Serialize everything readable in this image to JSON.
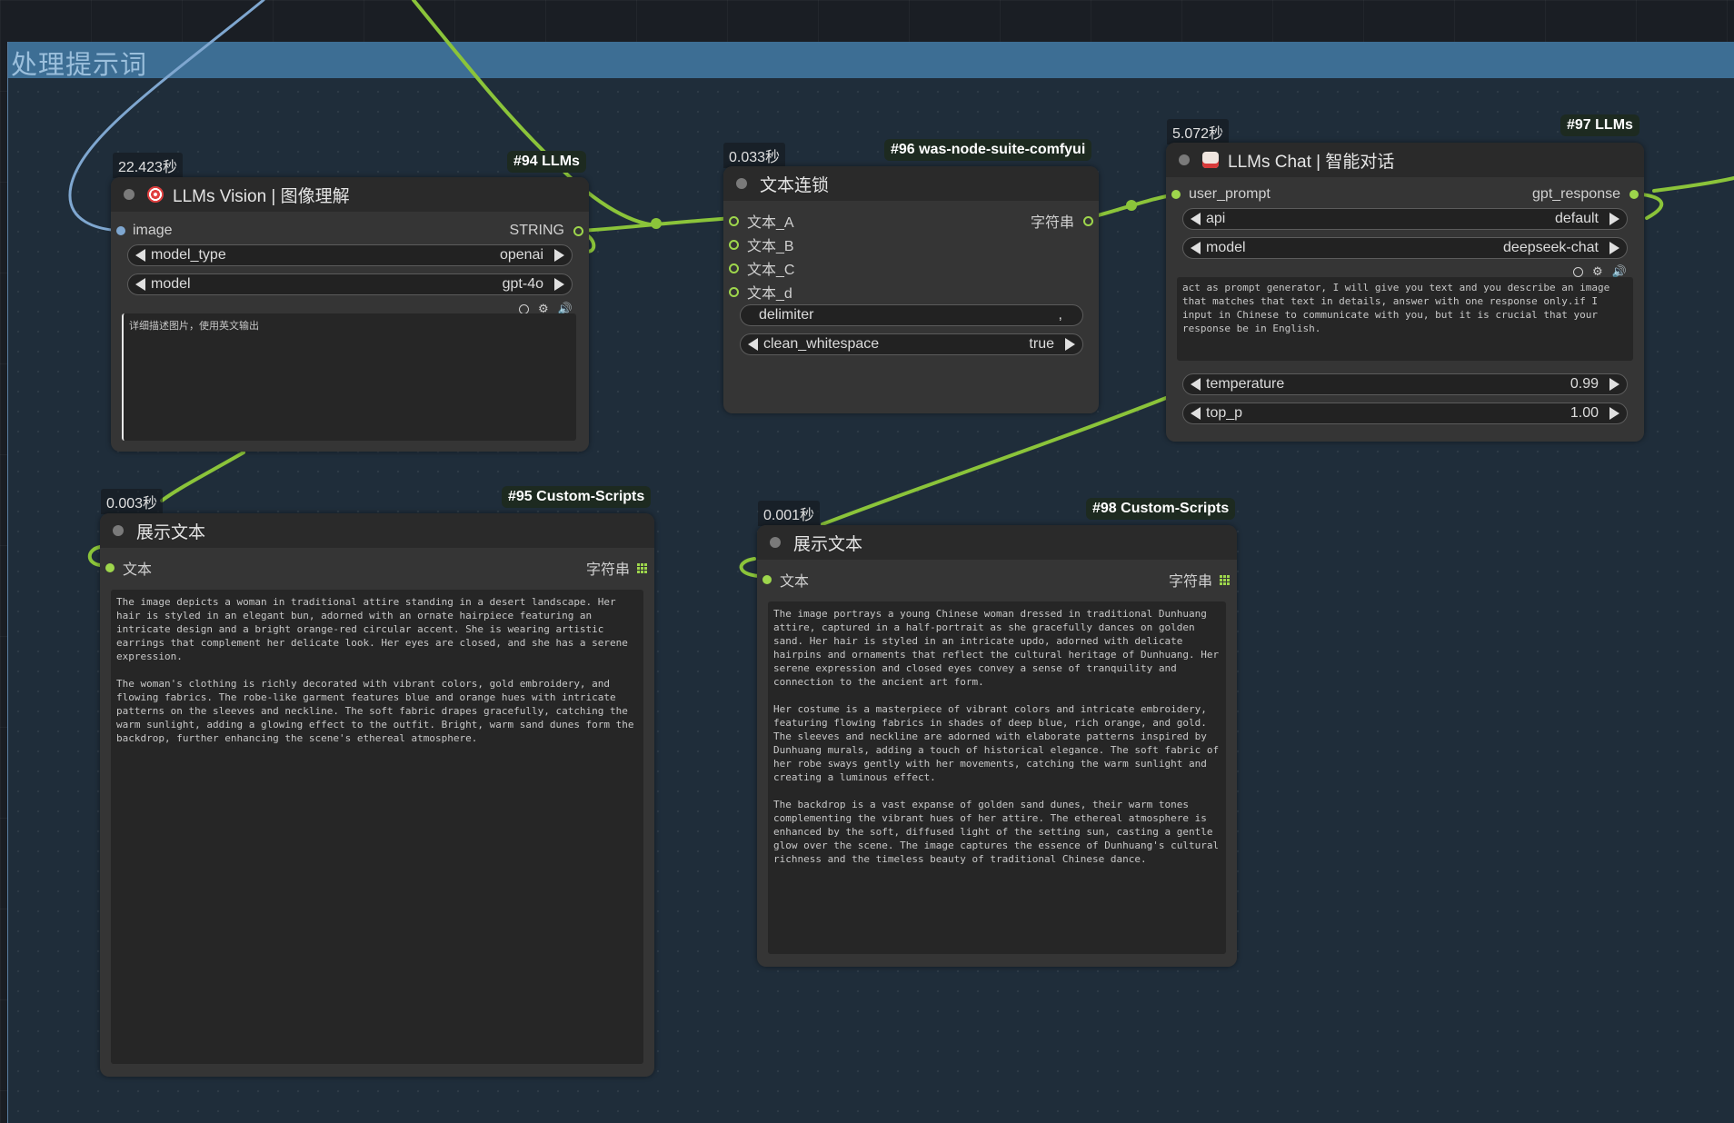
{
  "group": {
    "title": "处理提示词"
  },
  "colors": {
    "link_green": "#8bc43a",
    "link_blue": "#7fa7d0",
    "node_bg": "#353535",
    "group_header": "#3d6e94"
  },
  "nodes": {
    "n94": {
      "time": "22.423秒",
      "badge": "#94 LLMs",
      "title": "LLMs Vision | 图像理解",
      "input": "image",
      "output": "STRING",
      "widgets": [
        {
          "label": "model_type",
          "value": "openai"
        },
        {
          "label": "model",
          "value": "gpt-4o"
        }
      ],
      "prompt": "详细描述图片，使用英文输出",
      "icons": [
        "circle-icon",
        "gear-icon",
        "speaker-icon"
      ]
    },
    "n96": {
      "time": "0.033秒",
      "badge": "#96 was-node-suite-comfyui",
      "title": "文本连锁",
      "inputs": [
        "文本_A",
        "文本_B",
        "文本_C",
        "文本_d"
      ],
      "output": "字符串",
      "delimiter": {
        "label": "delimiter",
        "value": ","
      },
      "clean_whitespace": {
        "label": "clean_whitespace",
        "value": "true"
      }
    },
    "n97": {
      "time": "5.072秒",
      "badge": "#97 LLMs",
      "title": "LLMs Chat | 智能对话",
      "input": "user_prompt",
      "output": "gpt_response",
      "widgets_top": [
        {
          "label": "api",
          "value": "default"
        },
        {
          "label": "model",
          "value": "deepseek-chat"
        }
      ],
      "prompt": "act as prompt generator, I will give you text and you describe an image that matches that text in details, answer with one response only.if I input in Chinese to communicate with you, but it is crucial that your response be in English.",
      "widgets_bottom": [
        {
          "label": "temperature",
          "value": "0.99"
        },
        {
          "label": "top_p",
          "value": "1.00"
        }
      ],
      "icons": [
        "circle-icon",
        "gear-icon",
        "speaker-icon"
      ]
    },
    "n95": {
      "time": "0.003秒",
      "badge": "#95 Custom-Scripts",
      "title": "展示文本",
      "input": "文本",
      "output": "字符串",
      "text": "The image depicts a woman in traditional attire standing in a desert landscape. Her hair is styled in an elegant bun, adorned with an ornate hairpiece featuring an intricate design and a bright orange-red circular accent. She is wearing artistic earrings that complement her delicate look. Her eyes are closed, and she has a serene expression.\n\nThe woman's clothing is richly decorated with vibrant colors, gold embroidery, and flowing fabrics. The robe-like garment features blue and orange hues with intricate patterns on the sleeves and neckline. The soft fabric drapes gracefully, catching the warm sunlight, adding a glowing effect to the outfit. Bright, warm sand dunes form the backdrop, further enhancing the scene's ethereal atmosphere."
    },
    "n98": {
      "time": "0.001秒",
      "badge": "#98 Custom-Scripts",
      "title": "展示文本",
      "input": "文本",
      "output": "字符串",
      "text": "The image portrays a young Chinese woman dressed in traditional Dunhuang attire, captured in a half-portrait as she gracefully dances on golden sand. Her hair is styled in an intricate updo, adorned with delicate hairpins and ornaments that reflect the cultural heritage of Dunhuang. Her serene expression and closed eyes convey a sense of tranquility and connection to the ancient art form.\n\nHer costume is a masterpiece of vibrant colors and intricate embroidery, featuring flowing fabrics in shades of deep blue, rich orange, and gold. The sleeves and neckline are adorned with elaborate patterns inspired by Dunhuang murals, adding a touch of historical elegance. The soft fabric of her robe sways gently with her movements, catching the warm sunlight and creating a luminous effect.\n\nThe backdrop is a vast expanse of golden sand dunes, their warm tones complementing the vibrant hues of her attire. The ethereal atmosphere is enhanced by the soft, diffused light of the setting sun, casting a gentle glow over the scene. The image captures the essence of Dunhuang's cultural richness and the timeless beauty of traditional Chinese dance."
    }
  }
}
